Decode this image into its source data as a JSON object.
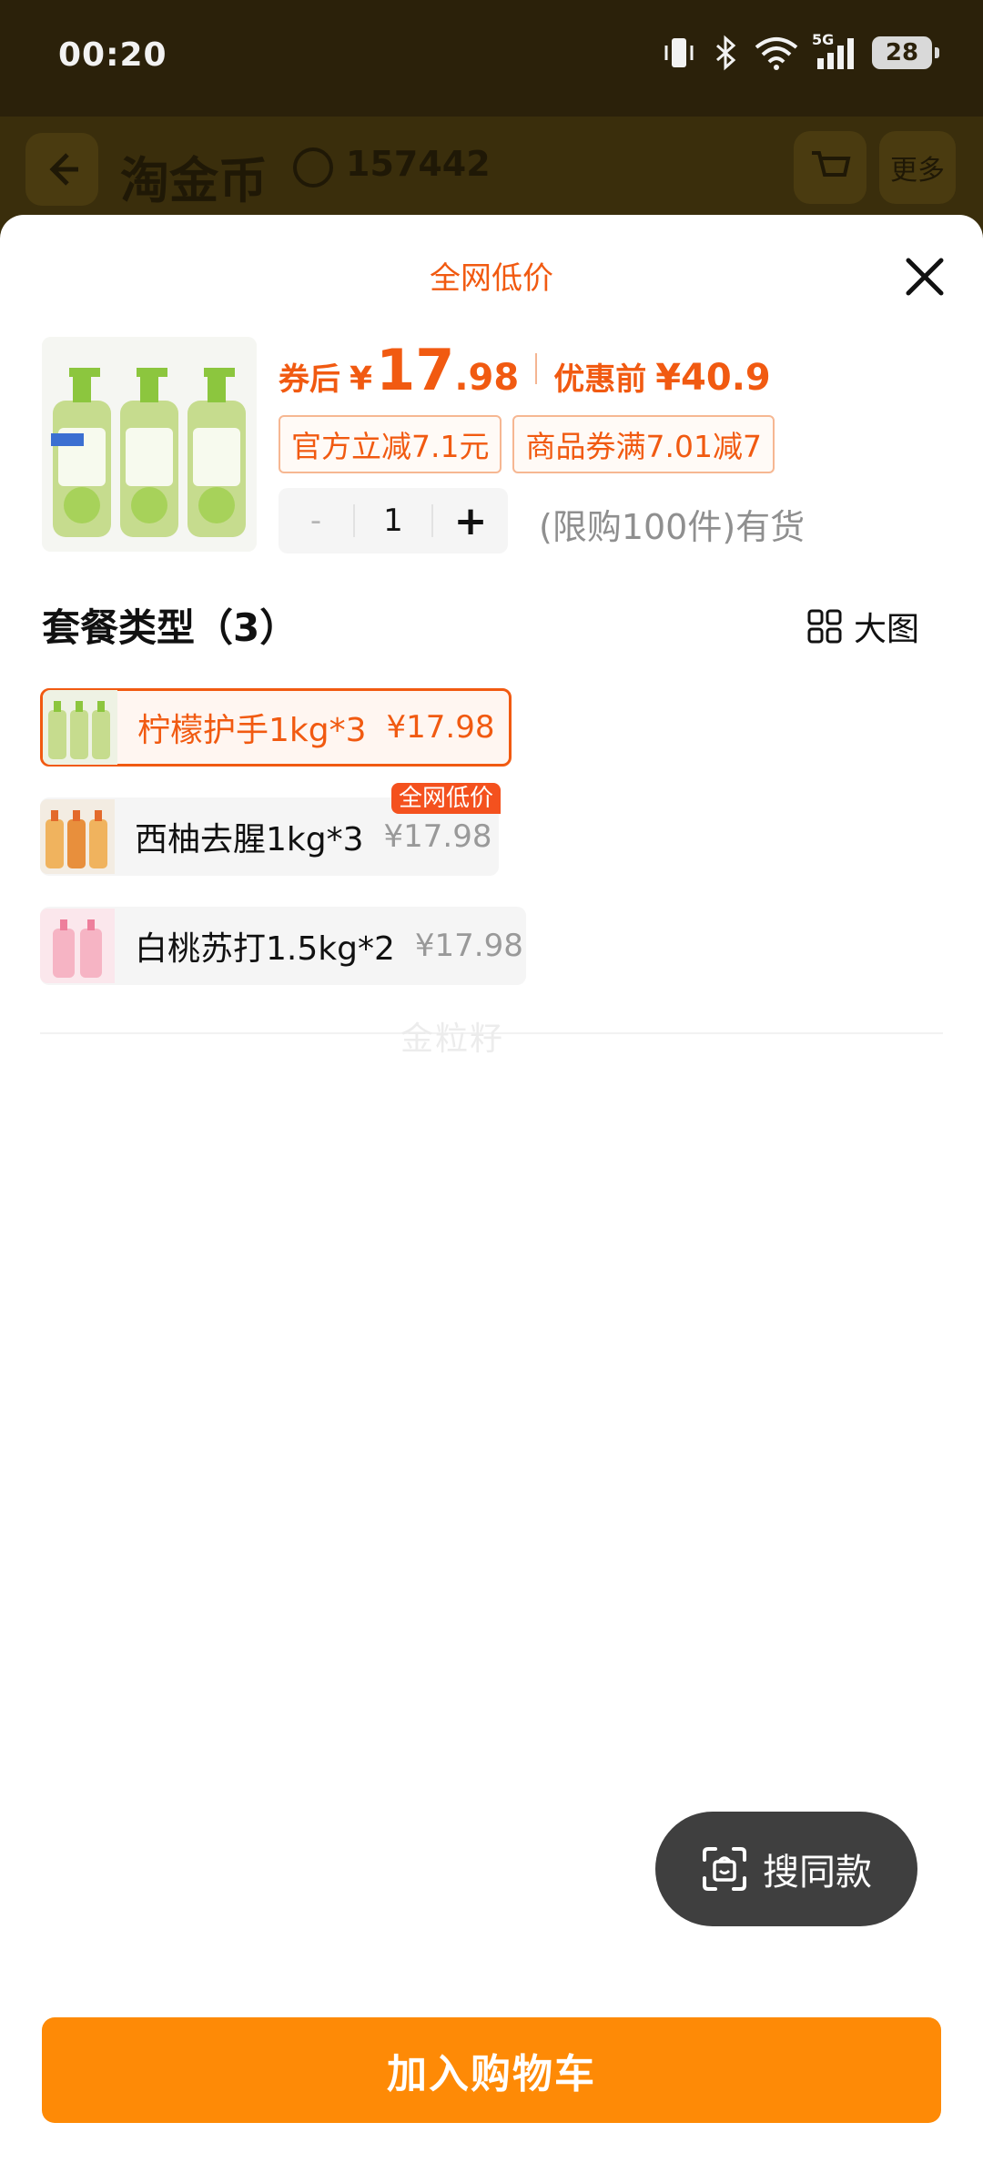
{
  "status_bar": {
    "time": "00:20",
    "network": "5G",
    "battery": "28"
  },
  "background_page": {
    "title": "淘金币",
    "coin_count": "157442",
    "more_label": "更多"
  },
  "sheet": {
    "title": "全网低价",
    "price": {
      "after_coupon_label": "券后",
      "currency": "¥",
      "price_int": "17",
      "price_dec": ".98",
      "before_label": "优惠前",
      "before_price": "¥40.9"
    },
    "tags": [
      "官方立减7.1元",
      "商品券满7.01减7"
    ],
    "quantity": {
      "minus": "-",
      "value": "1",
      "plus": "+"
    },
    "stock_text": "(限购100件)有货",
    "section_title": "套餐类型（3）",
    "big_view_label": "大图",
    "options": [
      {
        "name": "柠檬护手1kg*3",
        "price": "¥17.98",
        "selected": true
      },
      {
        "name": "西柚去腥1kg*3",
        "price": "¥17.98",
        "badge": "全网低价"
      },
      {
        "name": "白桃苏打1.5kg*2",
        "price": "¥17.98"
      }
    ],
    "watermark": "金粒籽",
    "search_same_label": "搜同款",
    "add_to_cart_label": "加入购物车"
  },
  "colors": {
    "accent": "#f15a11",
    "cart_button": "#fe8a06",
    "overlay": "#3a2e0c"
  }
}
